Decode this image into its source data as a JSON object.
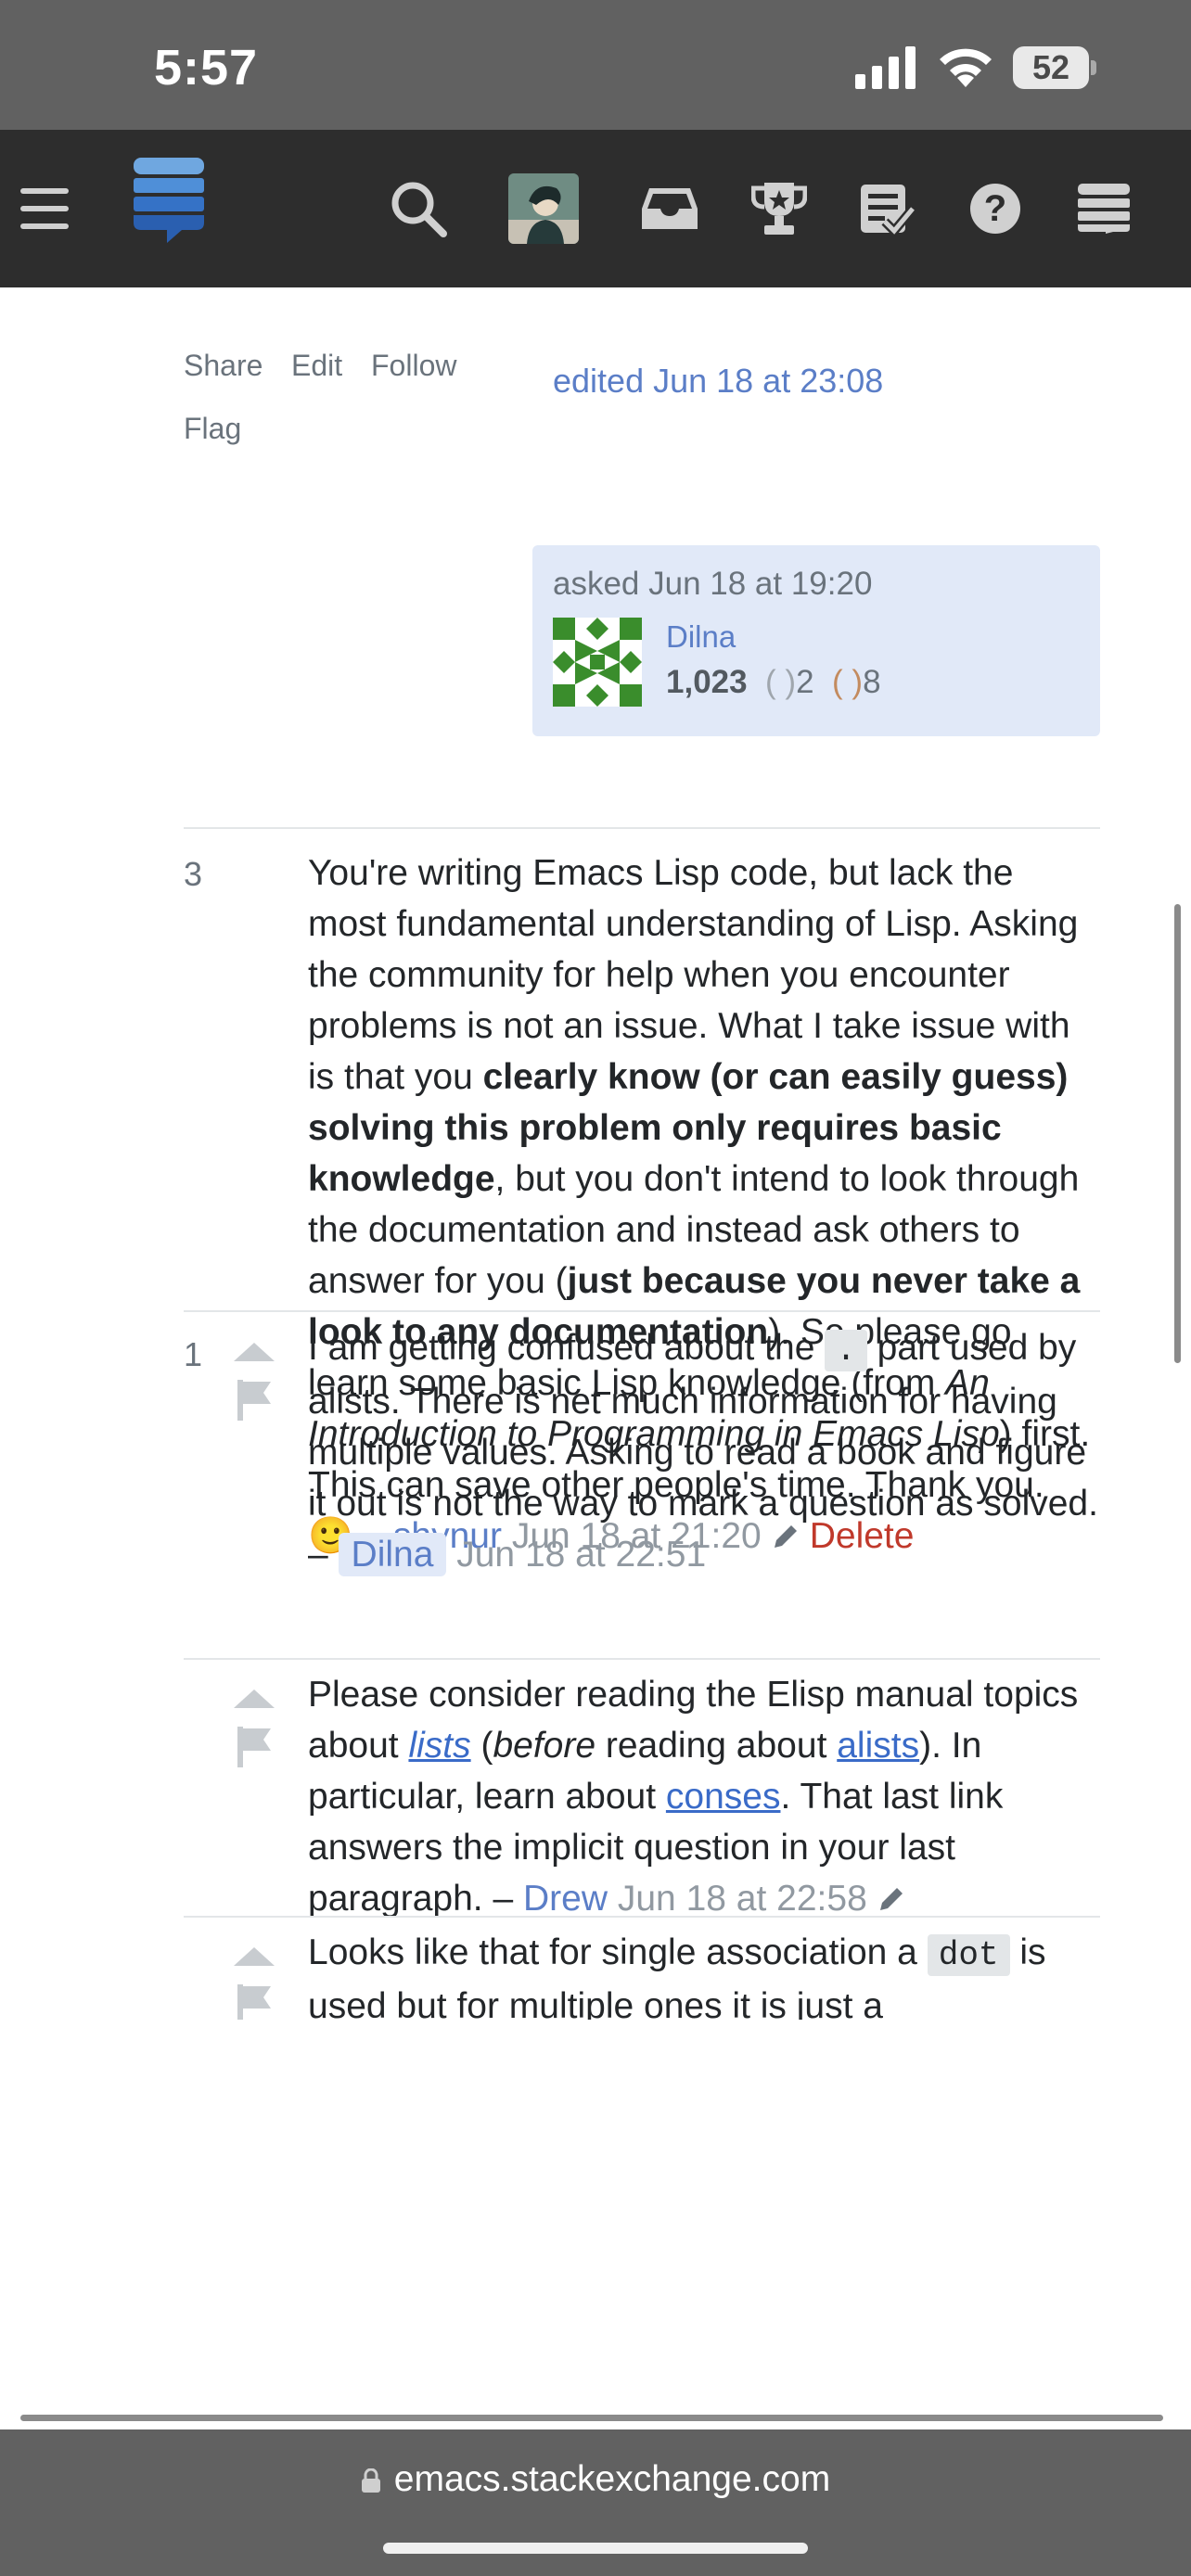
{
  "status_bar": {
    "time": "5:57",
    "battery": "52"
  },
  "nav": {
    "icons": [
      "hamburger-menu-icon",
      "stackexchange-logo",
      "search-icon",
      "user-avatar",
      "inbox-icon",
      "achievements-trophy-icon",
      "review-queue-icon",
      "help-icon",
      "site-switcher-icon"
    ]
  },
  "post_menu": {
    "share": "Share",
    "edit": "Edit",
    "follow": "Follow",
    "flag": "Flag",
    "edited": "edited Jun 18 at 23:08"
  },
  "asker": {
    "asked": "asked Jun 18 at 19:20",
    "name": "Dilna",
    "reputation": "1,023",
    "silver_badges": "2",
    "bronze_badges": "8",
    "identicon_color": "#3a8d2c"
  },
  "comments": [
    {
      "score": "3",
      "p1": "You're writing Emacs Lisp code, but lack the most fundamental understanding of Lisp. Asking the community for help when you encounter problems is not an issue. What I take issue with is that you ",
      "b1": "clearly know (or can easily guess) solving this problem only requires basic knowledge",
      "p2": ", but you don't intend to look through the documentation and instead ask others to answer for you (",
      "b2": "just because you never take a look to any documentation",
      "p3": "). So please go learn some basic Lisp knowledge (from ",
      "i1": "An Introduction to Programming in Emacs Lisp",
      "p4": ") first. This can save other people's time. Thank you. 🙂 – ",
      "user": "shynur",
      "date": " Jun 18 at 21:20",
      "delete": "Delete"
    },
    {
      "score": "1",
      "p1": "I am getting confused about the ",
      "code": ".",
      "p2": " part used by alists. There is net much information for having multiple values. Asking to read a book and figure it out is not the way to mark a question as solved. – ",
      "user": "Dilna",
      "date": " Jun 18 at 22:51"
    },
    {
      "p1": "Please consider reading the Elisp manual topics about ",
      "link1": "lists",
      "p2": " (",
      "i1": "before",
      "p3": " reading about ",
      "link2": "alists",
      "p4": "). In particular, learn about ",
      "link3": "conses",
      "p5": ". That last link answers the implicit question in your last paragraph. – ",
      "user": "Drew",
      "date": " Jun 18 at 22:58"
    },
    {
      "p1": "Looks like that for single association a ",
      "code": "dot",
      "p2": " is used but for multiple ones it is just a"
    }
  ],
  "browser": {
    "url": "emacs.stackexchange.com"
  },
  "colors": {
    "link": "#5b7ec7",
    "delete": "#c0392b",
    "nav_bg": "#2d2d2d",
    "status_bg": "#616161"
  }
}
